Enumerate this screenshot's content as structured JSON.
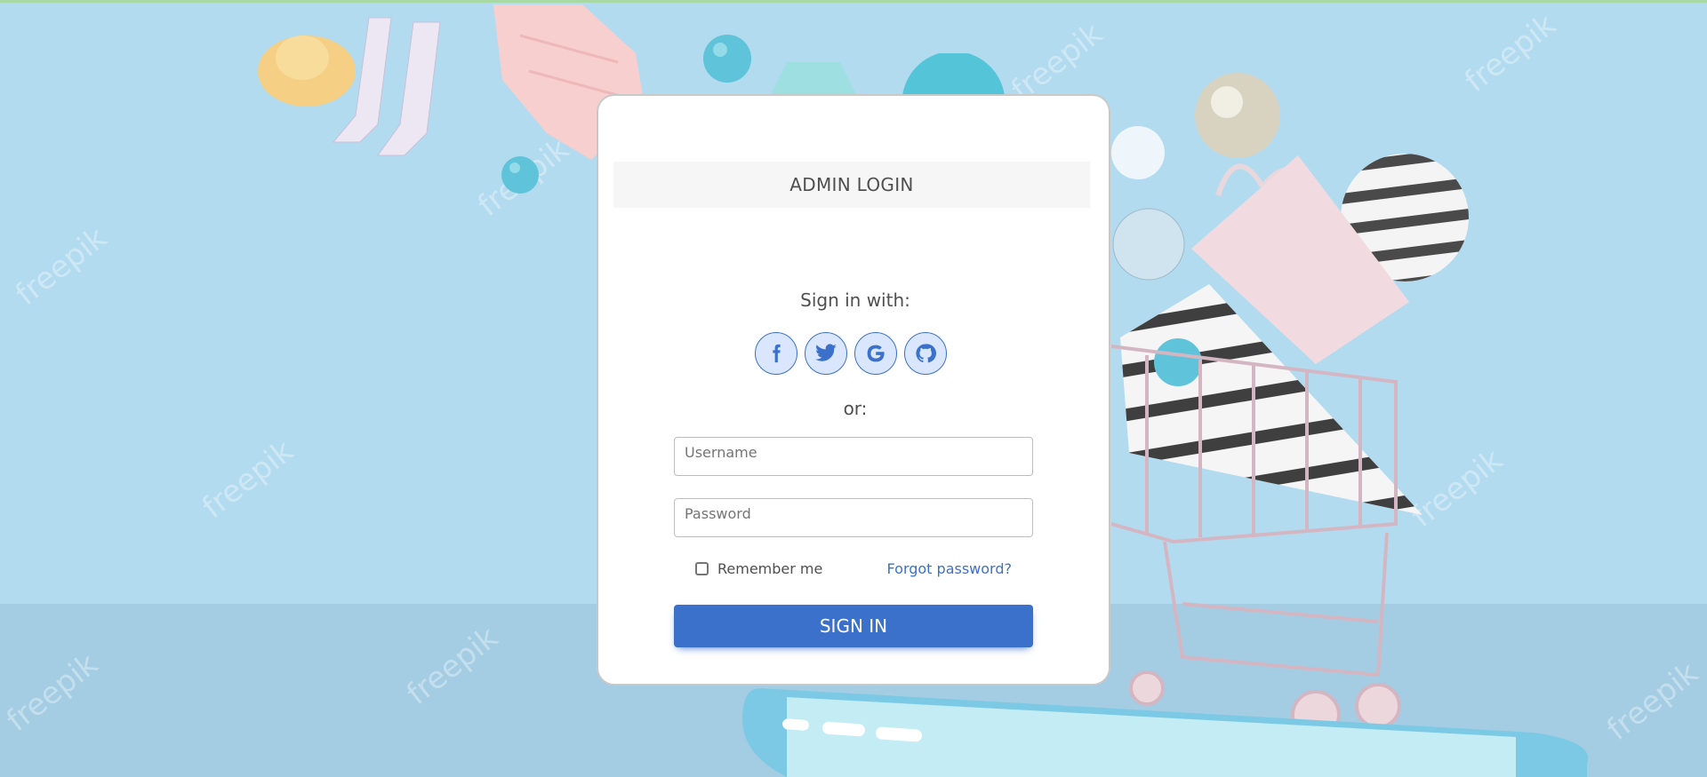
{
  "card": {
    "header": "ADMIN LOGIN",
    "sign_in_with": "Sign in with:",
    "or": "or:",
    "social": [
      {
        "icon": "facebook-icon"
      },
      {
        "icon": "twitter-icon"
      },
      {
        "icon": "google-icon"
      },
      {
        "icon": "github-icon"
      }
    ],
    "username": {
      "label": "Username",
      "value": ""
    },
    "password": {
      "label": "Password",
      "value": ""
    },
    "remember_label": "Remember me",
    "remember_checked": false,
    "forgot_label": "Forgot password?",
    "submit_label": "SIGN IN"
  },
  "background": {
    "watermark": "freepik"
  },
  "colors": {
    "accent": "#3b71ca",
    "social_bg": "#d9e6fb",
    "background": "#b3dbef"
  }
}
